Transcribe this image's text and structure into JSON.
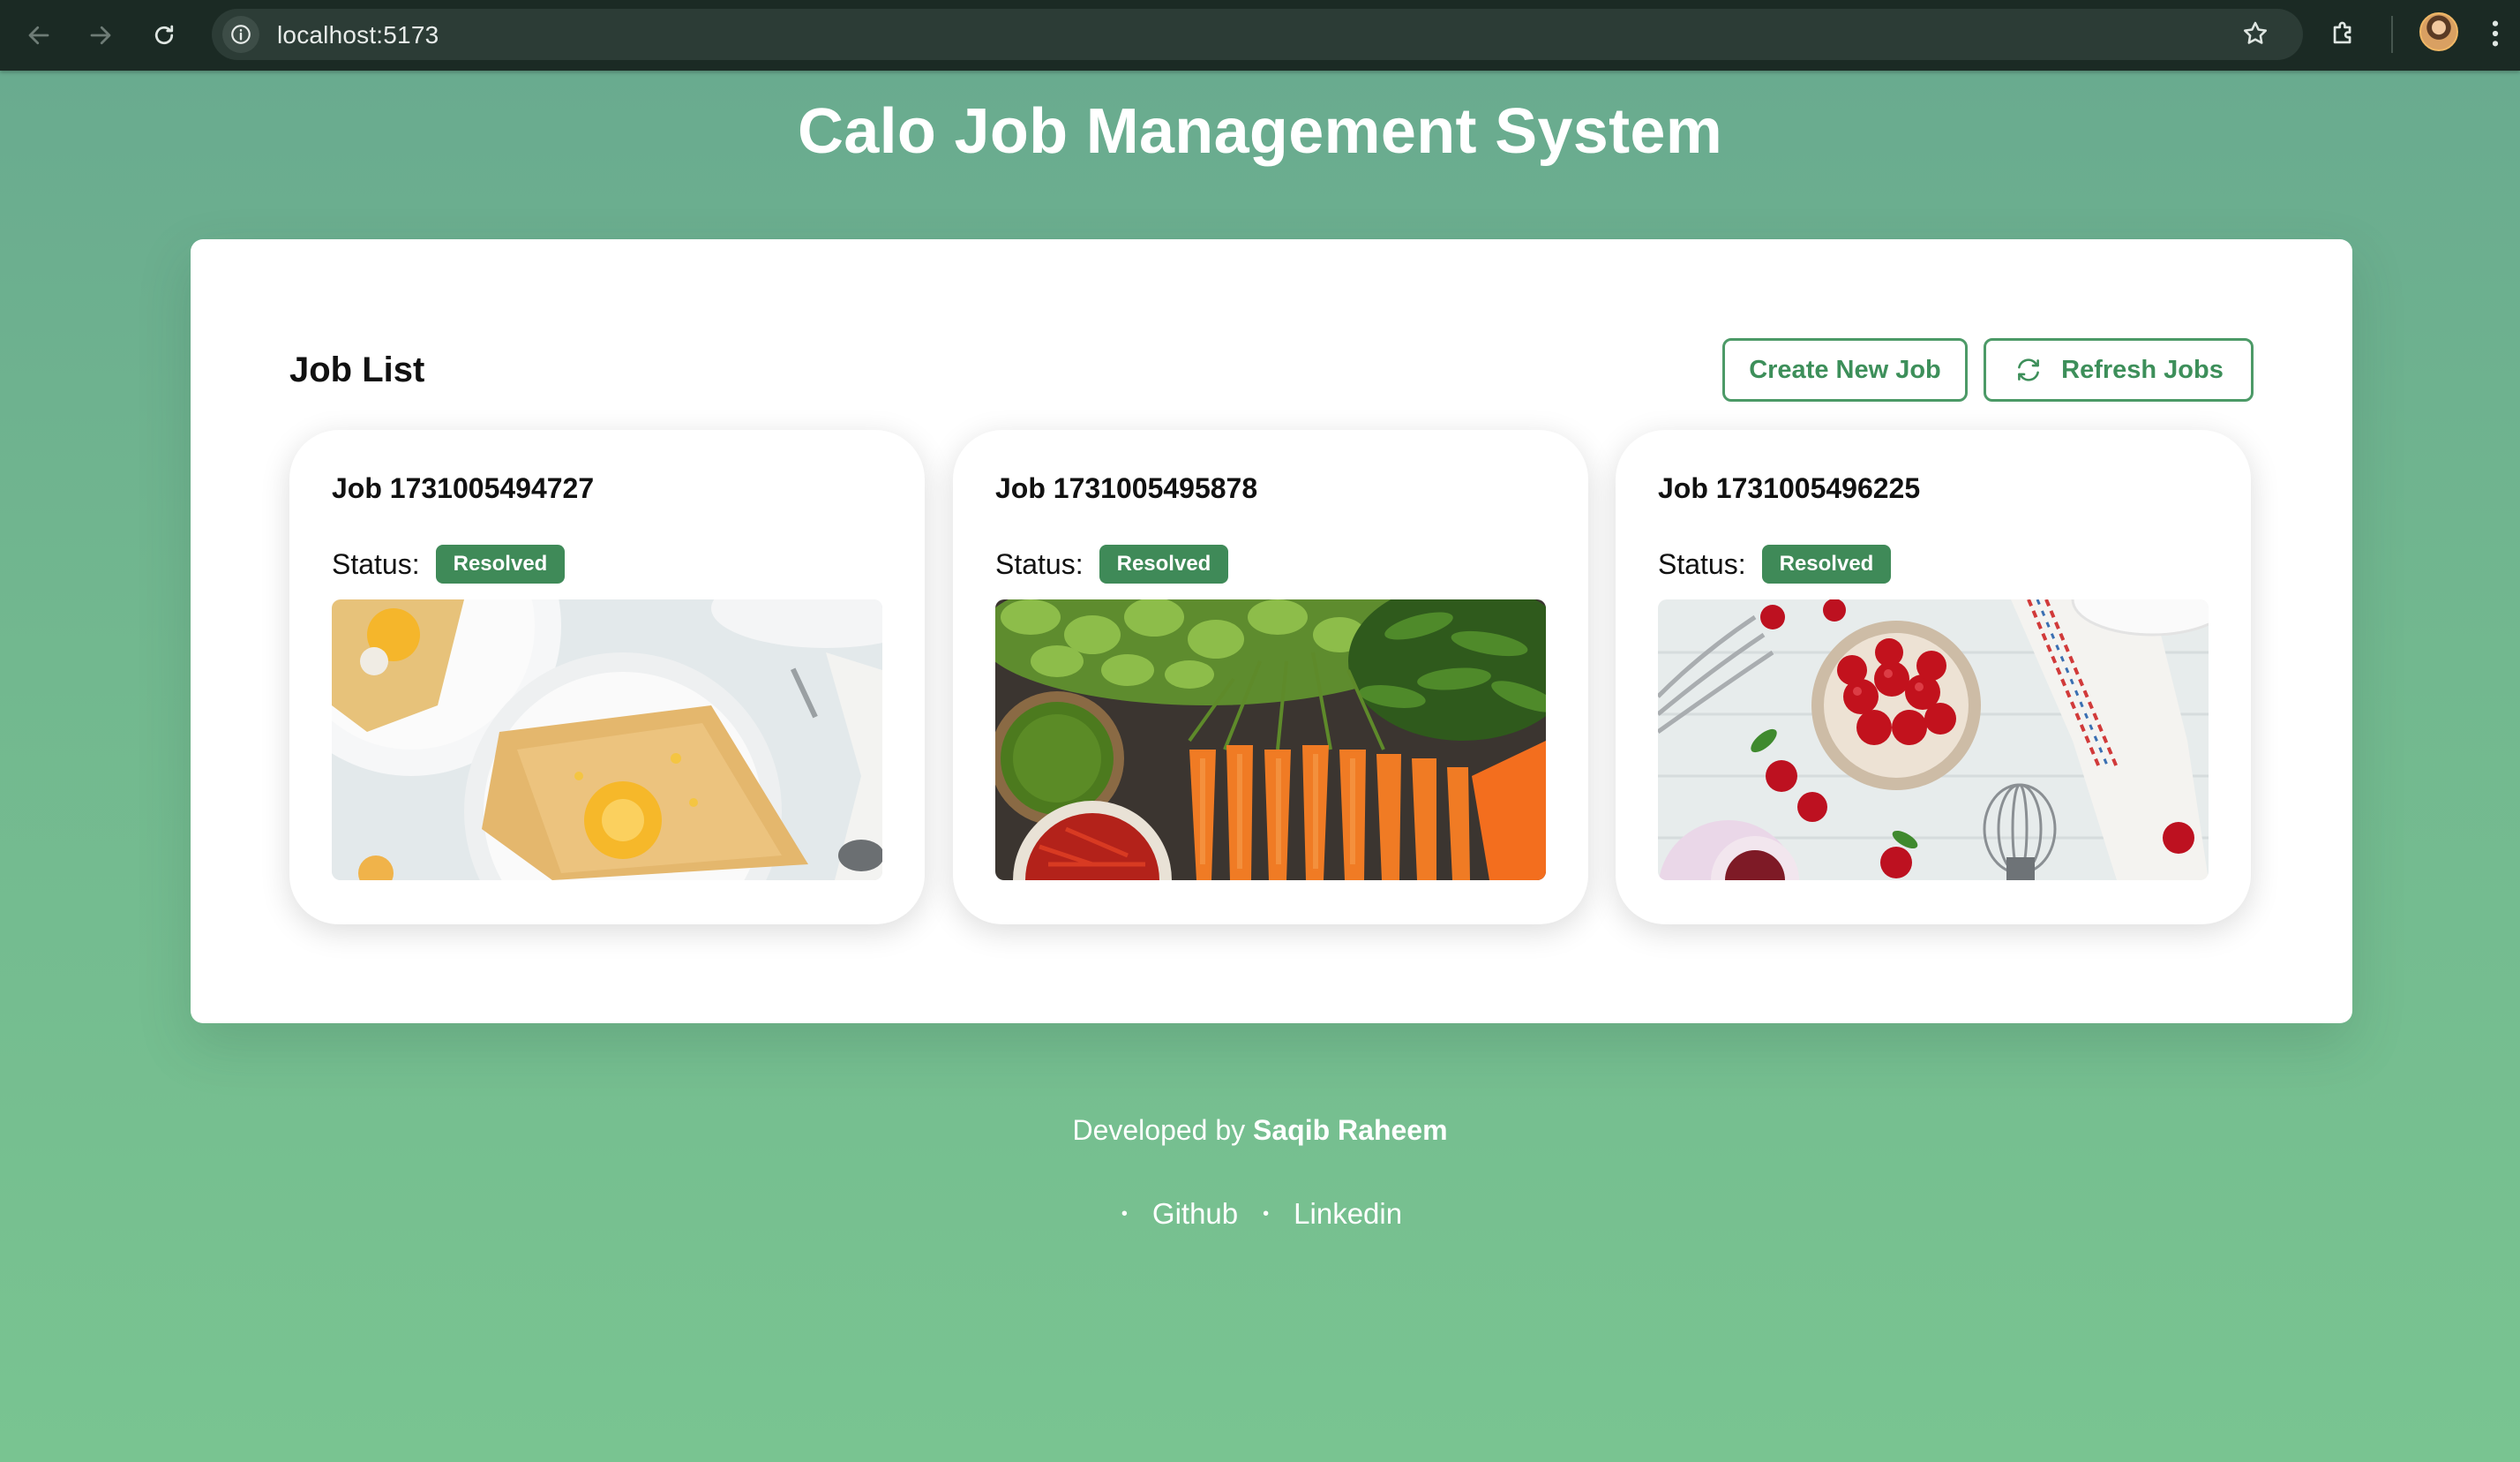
{
  "browser": {
    "url": "localhost:5173",
    "back_icon": "back-arrow-icon",
    "forward_icon": "forward-arrow-icon",
    "reload_icon": "reload-icon",
    "bookmark_icon": "star-icon",
    "extensions_icon": "puzzle-icon",
    "menu_icon": "kebab-menu-icon"
  },
  "page": {
    "title": "Calo Job Management System"
  },
  "job_list": {
    "title": "Job List",
    "create_label": "Create New Job",
    "refresh_label": "Refresh Jobs",
    "refresh_icon": "refresh-icon",
    "status_label": "Status:",
    "jobs": [
      {
        "title": "Job 1731005494727",
        "status": "Resolved",
        "image": "crepes-with-orange"
      },
      {
        "title": "Job 1731005495878",
        "status": "Resolved",
        "image": "vegetables-market"
      },
      {
        "title": "Job 1731005496225",
        "status": "Resolved",
        "image": "cherries-bowl"
      }
    ]
  },
  "footer": {
    "prefix": "Developed by",
    "author": "Saqib Raheem",
    "links": [
      "Github",
      "Linkedin"
    ]
  },
  "colors": {
    "background_top": "#68a98f",
    "background_bottom": "#79c491",
    "accent": "#3d8f5a",
    "badge": "#3f8a58"
  }
}
